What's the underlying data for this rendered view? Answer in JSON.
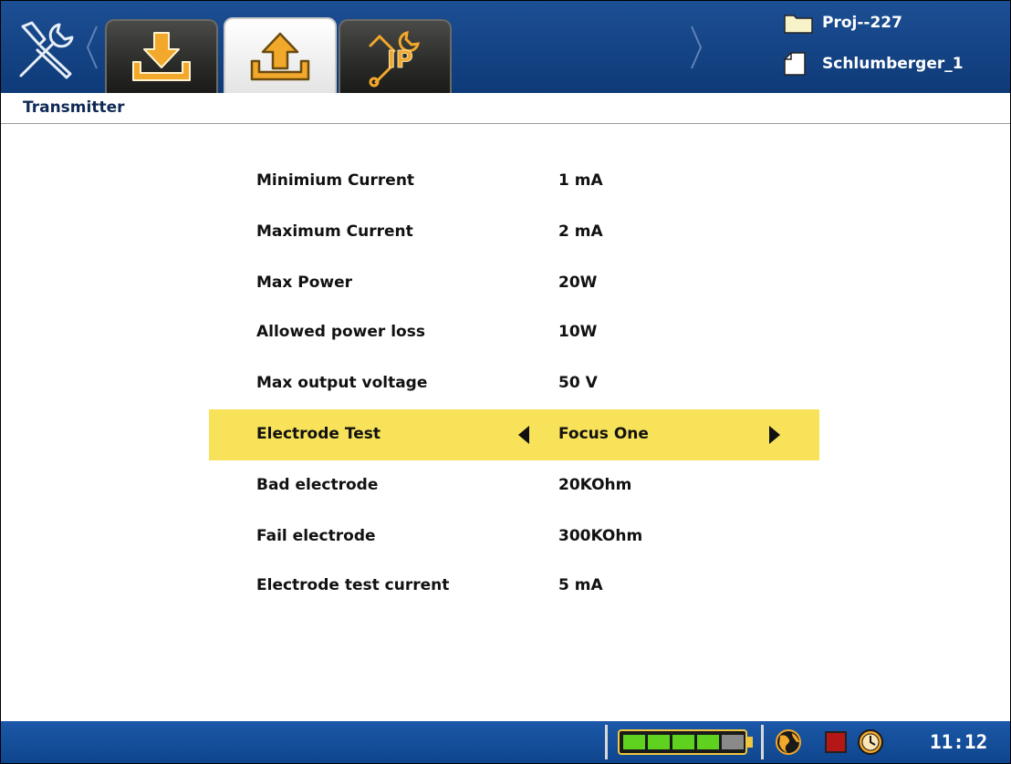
{
  "header": {
    "tabs": [
      {
        "name": "download-tab",
        "icon": "download-icon",
        "active": false
      },
      {
        "name": "upload-tab",
        "icon": "upload-icon",
        "active": true
      },
      {
        "name": "ip-tools-tab",
        "icon": "ip-tools-icon",
        "active": false
      }
    ],
    "project": {
      "folder_label": "Proj--227",
      "file_label": "Schlumberger_1"
    }
  },
  "page": {
    "title": "Transmitter"
  },
  "settings": [
    {
      "label": "Minimium Current",
      "value": "1 mA"
    },
    {
      "label": "Maximum Current",
      "value": "2 mA"
    },
    {
      "label": "Max Power",
      "value": "20W"
    },
    {
      "label": "Allowed power loss",
      "value": "10W"
    },
    {
      "label": "Max output voltage",
      "value": "50 V"
    },
    {
      "label": "Electrode Test",
      "value": "Focus One",
      "selected": true
    },
    {
      "label": "Bad electrode",
      "value": "20KOhm"
    },
    {
      "label": "Fail electrode",
      "value": "300KOhm"
    },
    {
      "label": "Electrode test current",
      "value": "5 mA"
    }
  ],
  "status": {
    "battery_segments_filled": 4,
    "battery_segments_total": 5,
    "time": "11:12"
  },
  "colors": {
    "header_blue": "#1c4f94",
    "status_blue": "#1b58a8",
    "selected_row": "#f7e25a",
    "icon_orange": "#f2a82a",
    "battery_green": "#5fd21f"
  }
}
